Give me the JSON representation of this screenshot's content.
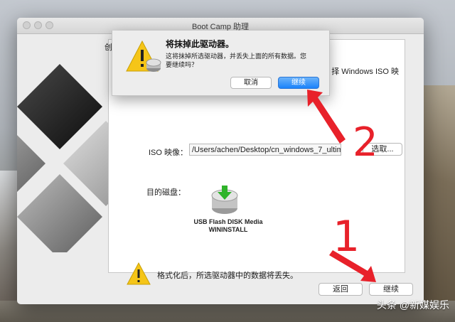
{
  "window": {
    "title": "Boot Camp 助理"
  },
  "panel": {
    "heading_left": "创",
    "heading_right": "择 Windows ISO 映",
    "iso_label": "ISO 映像：",
    "iso_path": "/Users/achen/Desktop/cn_windows_7_ultimate_w",
    "choose_button": "选取...",
    "disk_label": "目的磁盘：",
    "disk_name_line1": "USB Flash DISK Media",
    "disk_name_line2": "WININSTALL",
    "warning_text": "格式化后，所选驱动器中的数据将丢失。"
  },
  "footer": {
    "back_button": "返回",
    "continue_button": "继续"
  },
  "alert": {
    "title": "将抹掉此驱动器。",
    "message": "这将抹掉所选驱动器，并丢失上面的所有数据。您要继续吗？",
    "cancel_button": "取消",
    "continue_button": "继续"
  },
  "annotations": {
    "step1": "1",
    "step2": "2"
  },
  "watermark": "头条 @新媒娱乐",
  "colors": {
    "accent_blue": "#1a82fb",
    "annotation_red": "#e8212a",
    "warning_yellow": "#f5c518"
  }
}
